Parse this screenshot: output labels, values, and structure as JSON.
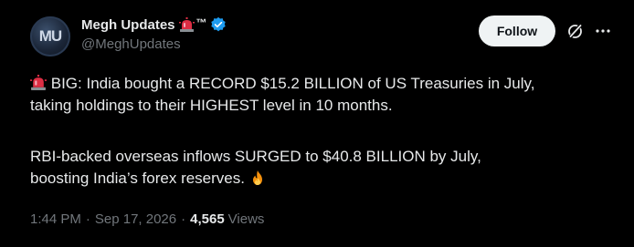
{
  "author": {
    "avatar_text": "MU",
    "display_name": "Megh Updates",
    "name_emoji": "siren-icon",
    "name_suffix": "™",
    "verified": "verified-badge-icon",
    "handle": "@MeghUpdates"
  },
  "actions": {
    "follow_label": "Follow",
    "grok_icon": "grok-icon",
    "more_icon": "more-icon"
  },
  "tweet": {
    "para1_line1": "BIG: India bought a RECORD $15.2 BILLION of US Treasuries in July,",
    "para1_line2": "taking holdings to their HIGHEST level in 10 months.",
    "para2_line1": "RBI-backed overseas inflows SURGED to $40.8 BILLION by July,",
    "para2_line2": "boosting India’s forex reserves.",
    "lead_emoji": "siren-icon",
    "trail_emoji": "fire-icon"
  },
  "meta": {
    "time": "1:44 PM",
    "separator": "·",
    "date": "Sep 17, 2026",
    "views_count": "4,565",
    "views_label": "Views"
  },
  "colors": {
    "background": "#000000",
    "text": "#e7e9ea",
    "secondary": "#71767b",
    "verified": "#1d9bf0",
    "follow_bg": "#eff3f4"
  }
}
